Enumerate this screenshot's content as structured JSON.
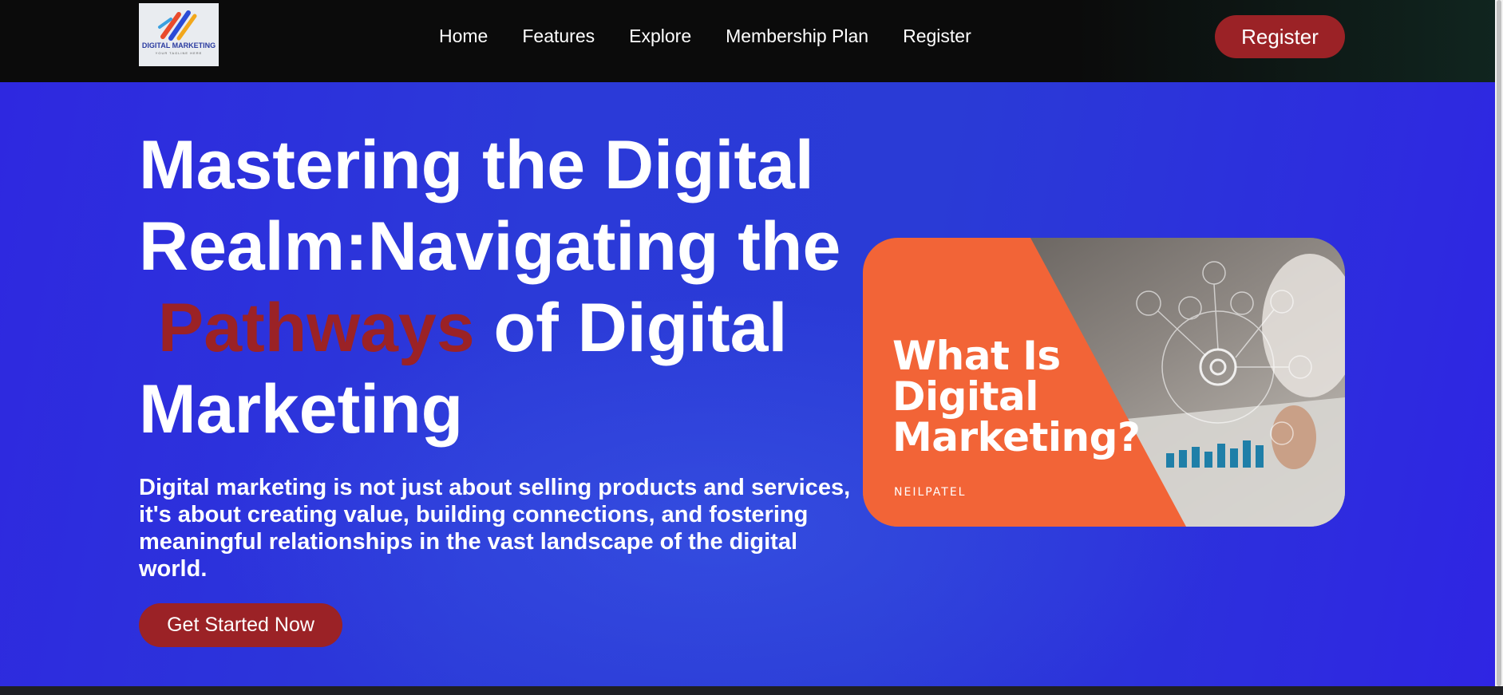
{
  "nav": {
    "logo": {
      "text": "DIGITAL MARKETING",
      "tagline": "YOUR TAGLINE HERE"
    },
    "links": [
      "Home",
      "Features",
      "Explore",
      "Membership Plan",
      "Register"
    ],
    "register_button": "Register"
  },
  "hero": {
    "title_line1": "Mastering the Digital",
    "title_line2": "Realm:Navigating the",
    "title_accent": "Pathways",
    "title_line3_rest": " of Digital",
    "title_line4": "Marketing",
    "description": "Digital marketing is not just about selling products and services, it's about creating value, building connections, and fostering meaningful relationships in the vast landscape of the digital world.",
    "cta_button": "Get Started Now",
    "image": {
      "heading_line1": "What Is Digital",
      "heading_line2": "Marketing?",
      "brand": "NEILPATEL"
    }
  },
  "colors": {
    "accent": "#9b2226",
    "hero_bg": "#2b3ad8",
    "nav_bg": "#0b0b0b",
    "image_orange": "#f26437"
  },
  "icons": [
    "digital-marketing-logo",
    "gear-icon",
    "cart-icon",
    "people-icon",
    "chart-icon"
  ]
}
